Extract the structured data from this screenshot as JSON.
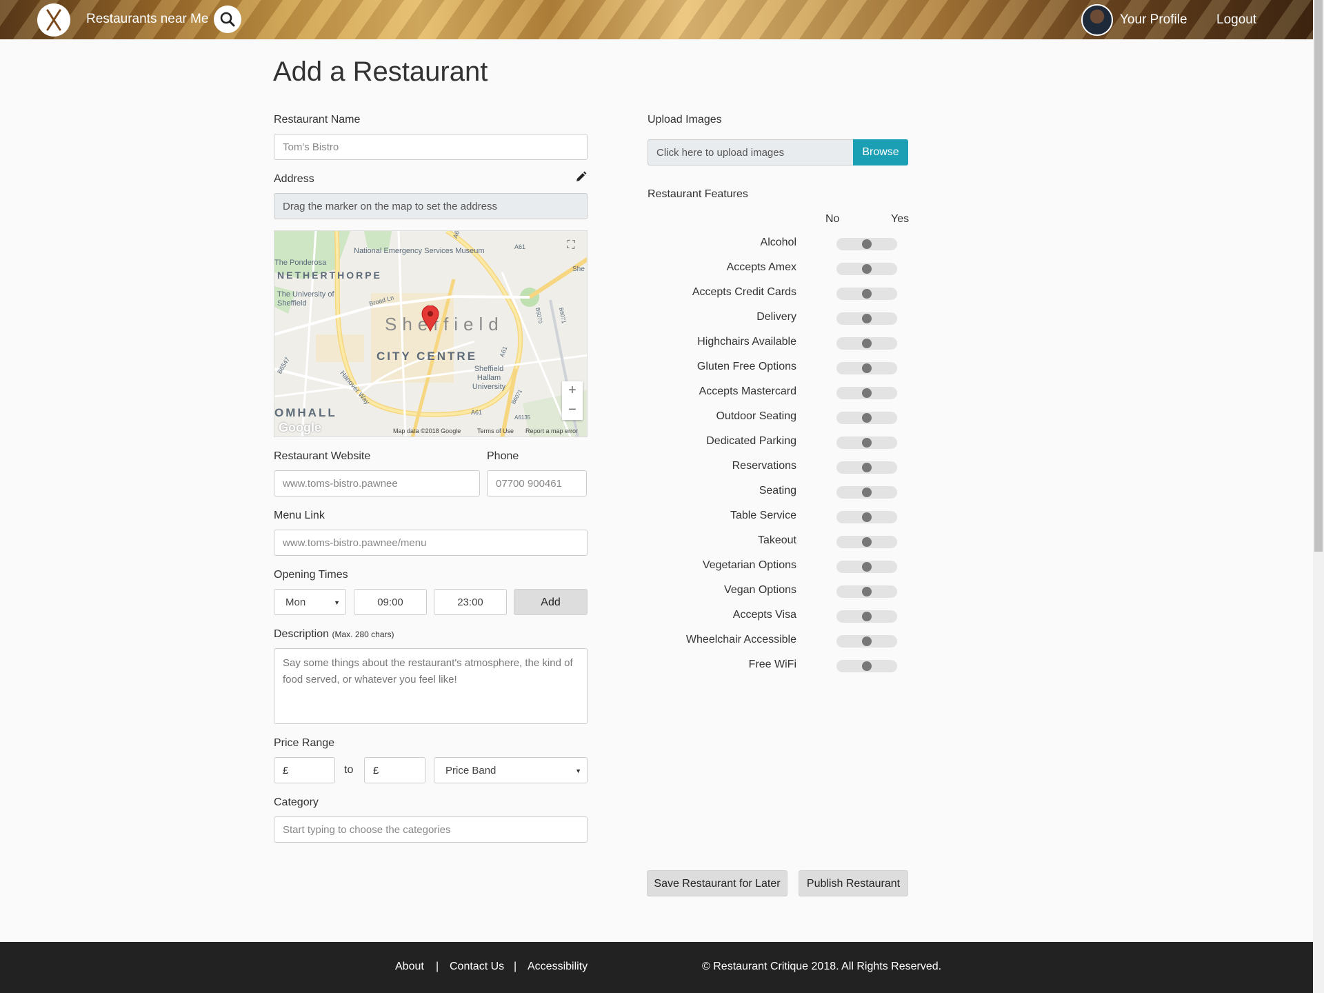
{
  "header": {
    "brand": "Restaurants near Me",
    "nav_profile": "Your Profile",
    "nav_logout": "Logout"
  },
  "page": {
    "title": "Add a Restaurant"
  },
  "form": {
    "name_label": "Restaurant Name",
    "name_placeholder": "Tom's Bistro",
    "address_label": "Address",
    "address_value": "Drag the marker on the map to set the address",
    "website_label": "Restaurant Website",
    "website_placeholder": "www.toms-bistro.pawnee",
    "phone_label": "Phone",
    "phone_placeholder": "07700 900461",
    "menu_label": "Menu Link",
    "menu_placeholder": "www.toms-bistro.pawnee/menu",
    "opening_label": "Opening Times",
    "day_value": "Mon",
    "open_time": "09:00",
    "close_time": "23:00",
    "add_label": "Add",
    "description_label": "Description",
    "description_hint": "(Max. 280 chars)",
    "description_placeholder": "Say some things about the restaurant's atmosphere, the kind of food served, or whatever you feel like!",
    "price_label": "Price Range",
    "price_from": "£",
    "price_to_text": "to",
    "price_to": "£",
    "price_band": "Price Band",
    "category_label": "Category",
    "category_placeholder": "Start typing to choose the categories"
  },
  "map": {
    "city": "Sheffield",
    "centre": "CITY CENTRE",
    "area_netherthorpe": "NETHERTHORPE",
    "area_broomhall": "OMHALL",
    "poi_museum": "National Emergency Services Museum",
    "poi_ponderosa": "The Ponderosa",
    "poi_university": "The University of Sheffield",
    "poi_hallam": "Sheffield Hallam University",
    "road_broad": "Broad Ln",
    "road_hanover": "Hanover Way",
    "road_a61": "A61",
    "road_a61b": "A61",
    "road_a61c": "A61",
    "road_b6547": "B6547",
    "road_b6070": "B6070",
    "road_b6071": "B6071",
    "road_b6071b": "B6071",
    "road_a6135": "A6135",
    "road_she": "She",
    "road_a6": "A6",
    "google": "Google",
    "map_data": "Map data ©2018 Google",
    "terms": "Terms of Use",
    "report": "Report a map error",
    "zoom_in": "+",
    "zoom_out": "−"
  },
  "upload": {
    "label": "Upload Images",
    "placeholder": "Click here to upload images",
    "browse": "Browse"
  },
  "features": {
    "label": "Restaurant Features",
    "no": "No",
    "yes": "Yes",
    "items": [
      {
        "label": "Alcohol",
        "value": "unset"
      },
      {
        "label": "Accepts Amex",
        "value": "unset"
      },
      {
        "label": "Accepts Credit Cards",
        "value": "unset"
      },
      {
        "label": "Delivery",
        "value": "unset"
      },
      {
        "label": "Highchairs Available",
        "value": "unset"
      },
      {
        "label": "Gluten Free Options",
        "value": "unset"
      },
      {
        "label": "Accepts Mastercard",
        "value": "unset"
      },
      {
        "label": "Outdoor Seating",
        "value": "unset"
      },
      {
        "label": "Dedicated Parking",
        "value": "unset"
      },
      {
        "label": "Reservations",
        "value": "unset"
      },
      {
        "label": "Seating",
        "value": "unset"
      },
      {
        "label": "Table Service",
        "value": "unset"
      },
      {
        "label": "Takeout",
        "value": "unset"
      },
      {
        "label": "Vegetarian Options",
        "value": "unset"
      },
      {
        "label": "Vegan Options",
        "value": "unset"
      },
      {
        "label": "Accepts Visa",
        "value": "unset"
      },
      {
        "label": "Wheelchair Accessible",
        "value": "unset"
      },
      {
        "label": "Free WiFi",
        "value": "unset"
      }
    ]
  },
  "actions": {
    "save_later": "Save Restaurant for Later",
    "publish": "Publish Restaurant"
  },
  "footer": {
    "about": "About",
    "contact": "Contact Us",
    "accessibility": "Accessibility",
    "sep": "|",
    "copyright": "© Restaurant Critique 2018. All Rights Reserved."
  },
  "colors": {
    "accent": "#1b9fb5",
    "footer_bg": "#222222",
    "marker": "#e53935"
  }
}
